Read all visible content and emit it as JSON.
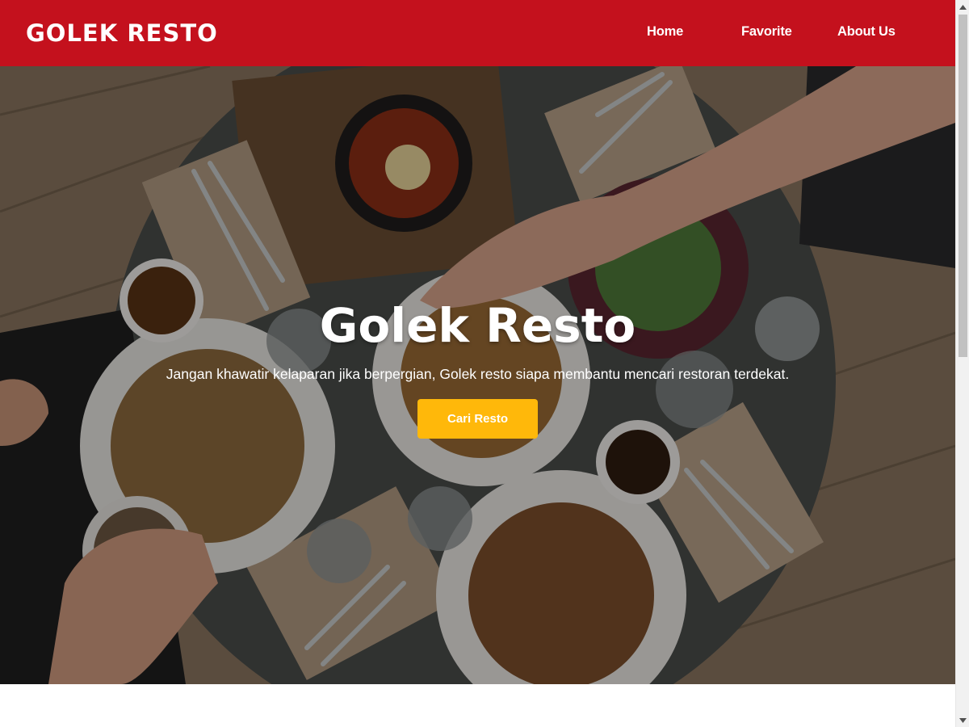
{
  "header": {
    "logo": "GOLEK RESTO",
    "nav": [
      {
        "label": "Home"
      },
      {
        "label": "Favorite"
      },
      {
        "label": "About Us"
      }
    ]
  },
  "hero": {
    "title": "Golek Resto",
    "subtitle": "Jangan khawatir kelaparan jika berpergian, Golek resto siapa membantu mencari restoran terdekat.",
    "cta_label": "Cari Resto"
  },
  "colors": {
    "header_bg": "#c4111d",
    "cta_bg": "#ffb80a",
    "text_light": "#ffffff"
  },
  "icons": {
    "scroll_up": "triangle-up",
    "scroll_down": "triangle-down"
  }
}
